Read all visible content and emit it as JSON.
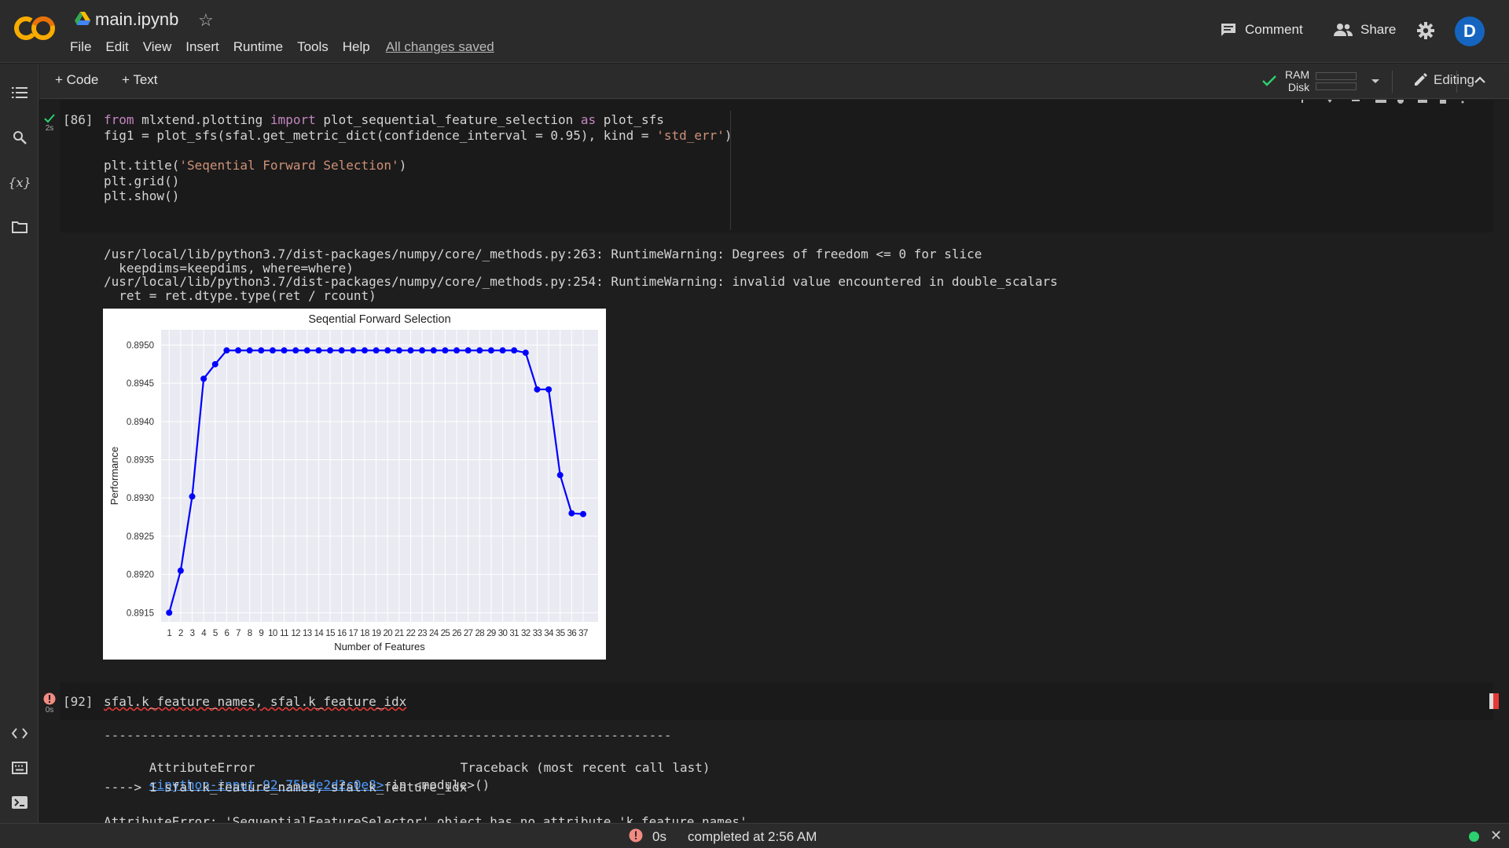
{
  "header": {
    "title": "main.ipynb",
    "menu": [
      "File",
      "Edit",
      "View",
      "Insert",
      "Runtime",
      "Tools",
      "Help"
    ],
    "save_status": "All changes saved",
    "comment_label": "Comment",
    "share_label": "Share",
    "avatar_letter": "D"
  },
  "toolbar": {
    "add_code": "+ Code",
    "add_text": "+ Text",
    "ram_label": "RAM",
    "disk_label": "Disk",
    "editing_label": "Editing"
  },
  "cell1": {
    "exec_count": "[86]",
    "duration": "2s",
    "code": [
      [
        {
          "t": "from",
          "c": "kw"
        },
        {
          "t": " mlxtend.plotting "
        },
        {
          "t": "import",
          "c": "kw"
        },
        {
          "t": " plot_sequential_feature_selection "
        },
        {
          "t": "as",
          "c": "kw"
        },
        {
          "t": " plot_sfs"
        }
      ],
      [
        {
          "t": "fig1 = plot_sfs(sfal.get_metric_dict(confidence_interval = 0.95), kind = "
        },
        {
          "t": "'std_err'",
          "c": "str"
        },
        {
          "t": ")"
        }
      ],
      [],
      [
        {
          "t": "plt.title("
        },
        {
          "t": "'Seqential Forward Selection'",
          "c": "str"
        },
        {
          "t": ")"
        }
      ],
      [
        {
          "t": "plt.grid()"
        }
      ],
      [
        {
          "t": "plt.show()"
        }
      ]
    ],
    "output": [
      "/usr/local/lib/python3.7/dist-packages/numpy/core/_methods.py:263: RuntimeWarning: Degrees of freedom <= 0 for slice",
      "  keepdims=keepdims, where=where)",
      "/usr/local/lib/python3.7/dist-packages/numpy/core/_methods.py:254: RuntimeWarning: invalid value encountered in double_scalars",
      "  ret = ret.dtype.type(ret / rcount)"
    ]
  },
  "chart_data": {
    "type": "line",
    "title": "Seqential Forward Selection",
    "xlabel": "Number of Features",
    "ylabel": "Performance",
    "x": [
      1,
      2,
      3,
      4,
      5,
      6,
      7,
      8,
      9,
      10,
      11,
      12,
      13,
      14,
      15,
      16,
      17,
      18,
      19,
      20,
      21,
      22,
      23,
      24,
      25,
      26,
      27,
      28,
      29,
      30,
      31,
      32,
      33,
      34,
      35,
      36,
      37
    ],
    "y": [
      0.8915,
      0.89205,
      0.89302,
      0.89456,
      0.89475,
      0.89493,
      0.89493,
      0.89493,
      0.89493,
      0.89493,
      0.89493,
      0.89493,
      0.89493,
      0.89493,
      0.89493,
      0.89493,
      0.89493,
      0.89493,
      0.89493,
      0.89493,
      0.89493,
      0.89493,
      0.89493,
      0.89493,
      0.89493,
      0.89493,
      0.89493,
      0.89493,
      0.89493,
      0.89493,
      0.89493,
      0.8949,
      0.89442,
      0.89442,
      0.8933,
      0.8928,
      0.89279
    ],
    "yticks": [
      "0.8915",
      "0.8920",
      "0.8925",
      "0.8930",
      "0.8935",
      "0.8940",
      "0.8945",
      "0.8950"
    ],
    "ylim": [
      0.89138,
      0.8952
    ],
    "grid": true,
    "series_color": "#0000ff",
    "background": "#eaeaf2"
  },
  "cell2": {
    "exec_count": "[92]",
    "duration": "0s",
    "code": "sfal.k_feature_names, sfal.k_feature_idx",
    "output": {
      "dashes": "---------------------------------------------------------------------------",
      "error_name": "AttributeError",
      "traceback_label": "Traceback (most recent call last)",
      "link": "<ipython-input-92-75bde2d2c0e8>",
      "in_module": " in <module>()",
      "arrow_line": "----> 1 sfal.k_feature_names, sfal.k_feature_idx",
      "last_line": "AttributeError: 'SequentialFeatureSelector' object has no attribute 'k_feature_names'"
    }
  },
  "statusbar": {
    "time": "0s",
    "message": "completed at 2:56 AM"
  },
  "colors": {
    "accent_orange": "#f9ab00",
    "error_red": "#f28b82",
    "success_green": "#2bd06f",
    "avatar_blue": "#1565c0"
  }
}
